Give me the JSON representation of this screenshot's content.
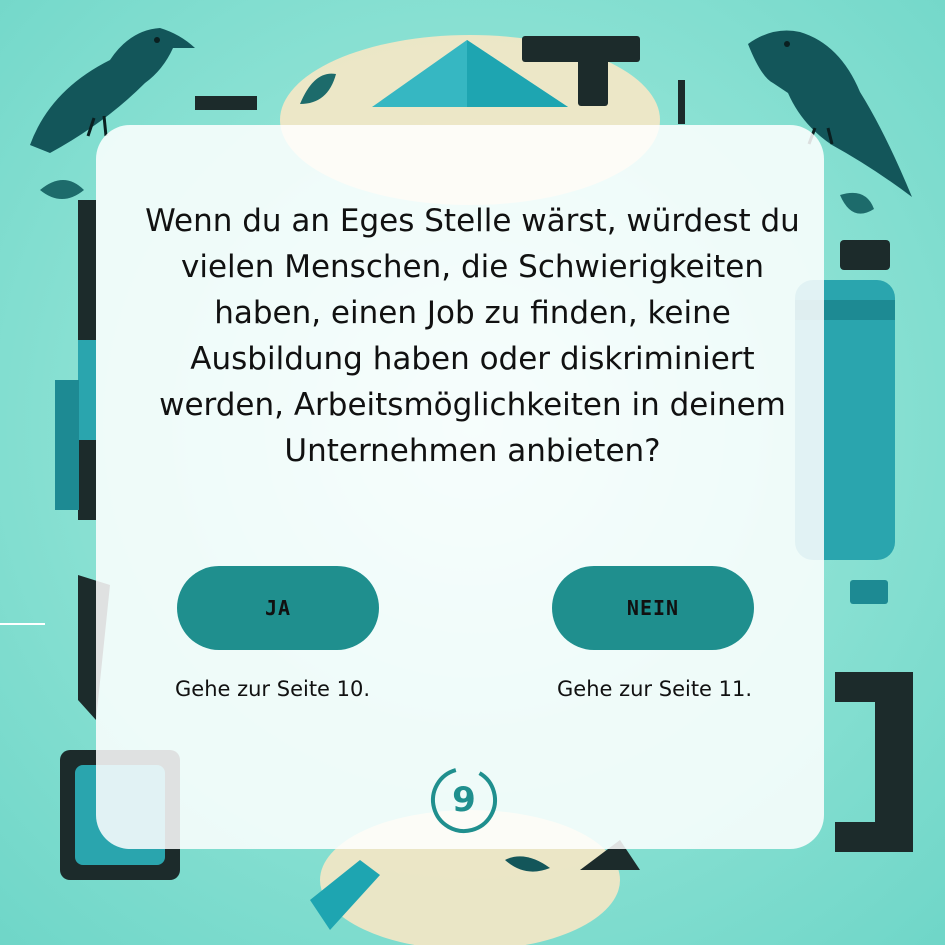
{
  "question": "Wenn du an Eges Stelle wärst, würdest du vielen Menschen, die Schwierigkeiten haben, einen Job zu finden, keine Ausbildung haben oder diskriminiert werden, Arbeitsmöglichkeiten in deinem Unternehmen anbieten?",
  "choices": [
    {
      "label": "JA",
      "hint": "Gehe zur Seite 10."
    },
    {
      "label": "NEIN",
      "hint": "Gehe zur Seite 11."
    }
  ],
  "page_number": "9",
  "colors": {
    "accent": "#1f8f8e",
    "background": "#8fe3d5",
    "card": "#ffffff",
    "text": "#111111",
    "dark_shape": "#1c2b2b"
  },
  "decor": {
    "icons": [
      "crow-icon",
      "crow-icon",
      "bottle-icon",
      "triangle-tool-icon",
      "t-shape-icon",
      "bracket-shape-icon"
    ]
  }
}
